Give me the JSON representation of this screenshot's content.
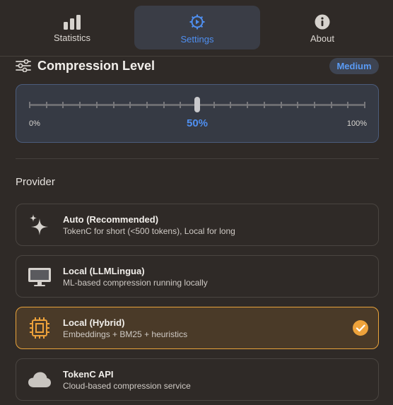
{
  "tabs": [
    {
      "label": "Statistics",
      "icon": "bar-chart-icon",
      "active": false
    },
    {
      "label": "Settings",
      "icon": "gear-icon",
      "active": true
    },
    {
      "label": "About",
      "icon": "info-icon",
      "active": false
    }
  ],
  "compression": {
    "title": "Compression Level",
    "badge": "Medium",
    "slider": {
      "min_label": "0%",
      "max_label": "100%",
      "value_label": "50%",
      "value": 50
    }
  },
  "provider": {
    "title": "Provider",
    "options": [
      {
        "name": "Auto (Recommended)",
        "description": "TokenC for short (<500 tokens), Local for long",
        "icon": "sparkles-icon",
        "selected": false
      },
      {
        "name": "Local (LLMLingua)",
        "description": "ML-based compression running locally",
        "icon": "monitor-icon",
        "selected": false
      },
      {
        "name": "Local (Hybrid)",
        "description": "Embeddings + BM25 + heuristics",
        "icon": "cpu-chip-icon",
        "selected": true
      },
      {
        "name": "TokenC API",
        "description": "Cloud-based compression service",
        "icon": "cloud-icon",
        "selected": false
      }
    ]
  },
  "colors": {
    "accent_blue": "#4f8ff0",
    "accent_orange": "#eda23b",
    "background": "#2f2a27"
  }
}
